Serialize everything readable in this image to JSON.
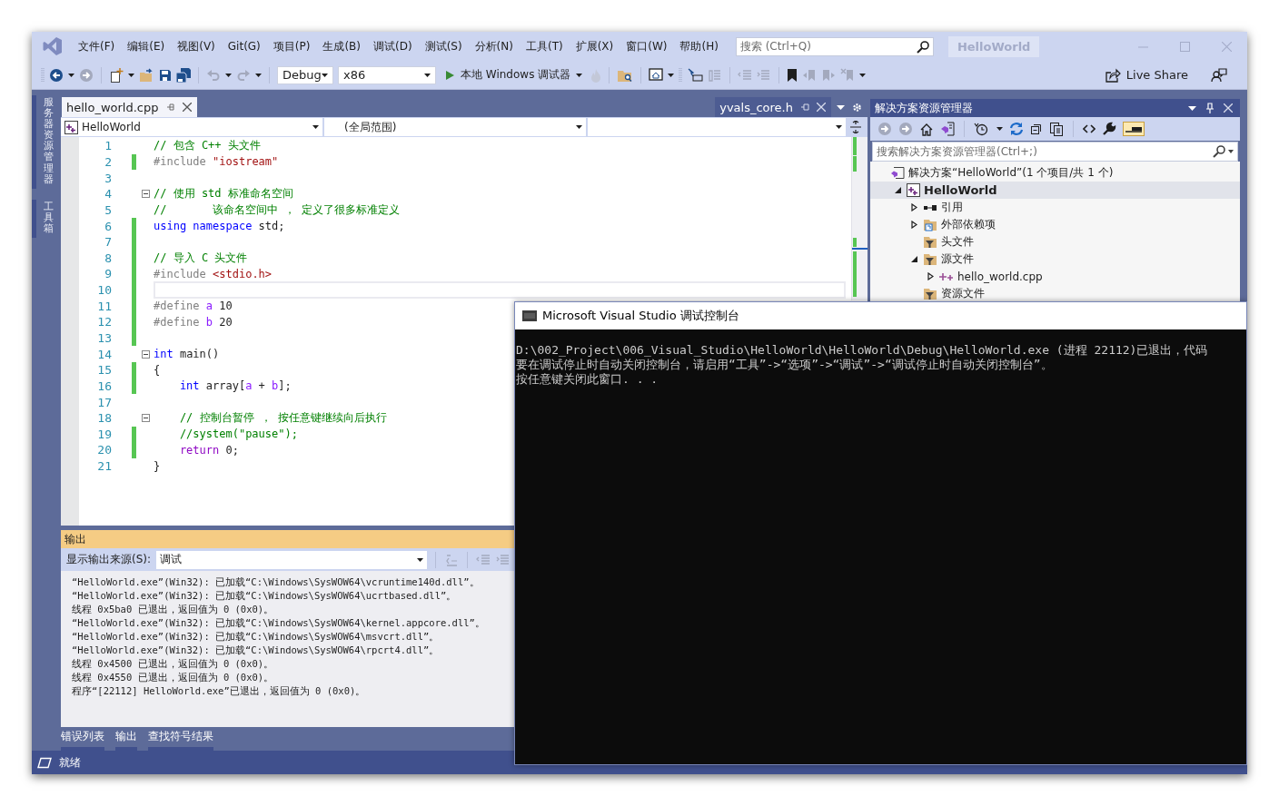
{
  "window": {
    "menu": [
      "文件(F)",
      "编辑(E)",
      "视图(V)",
      "Git(G)",
      "项目(P)",
      "生成(B)",
      "调试(D)",
      "测试(S)",
      "分析(N)",
      "工具(T)",
      "扩展(X)",
      "窗口(W)",
      "帮助(H)"
    ],
    "search": {
      "placeholder": "搜索 (Ctrl+Q)"
    },
    "solution_name": "HelloWorld"
  },
  "toolbar": {
    "configuration": "Debug",
    "platform": "x86",
    "debugger": "本地 Windows 调试器",
    "live_share": "Live Share"
  },
  "side_tabs": [
    "服务器资源管理器",
    "工具箱"
  ],
  "editor": {
    "tabs": [
      {
        "label": "hello_world.cpp",
        "kind": "document",
        "selected": true
      },
      {
        "label": "yvals_core.h",
        "kind": "preview",
        "selected": false
      }
    ],
    "project": "HelloWorld",
    "scope": "(全局范围)",
    "lines": [
      {
        "number": "1",
        "changed": false,
        "foldable": false,
        "current": false,
        "tokens": [
          {
            "kind": "comment",
            "text": "// 包含 C++ 头文件"
          }
        ]
      },
      {
        "number": "2",
        "changed": true,
        "foldable": false,
        "current": false,
        "tokens": [
          {
            "kind": "preproc",
            "text": "#include "
          },
          {
            "kind": "string",
            "text": "\"iostream\""
          }
        ]
      },
      {
        "number": "3",
        "changed": false,
        "foldable": false,
        "current": false
      },
      {
        "number": "4",
        "changed": false,
        "foldable": true,
        "current": false,
        "tokens": [
          {
            "kind": "comment",
            "text": "// 使用 std 标准命名空间"
          }
        ]
      },
      {
        "number": "5",
        "changed": false,
        "foldable": false,
        "current": false,
        "tokens": [
          {
            "kind": "comment",
            "text": "//       该命名空间中 ， 定义了很多标准定义"
          }
        ]
      },
      {
        "number": "6",
        "changed": true,
        "foldable": false,
        "current": false,
        "tokens": [
          {
            "kind": "keyword",
            "text": "using "
          },
          {
            "kind": "keyword",
            "text": "namespace"
          },
          {
            "kind": "plain",
            "text": " std;"
          }
        ]
      },
      {
        "number": "7",
        "changed": true,
        "foldable": false,
        "current": false
      },
      {
        "number": "8",
        "changed": true,
        "foldable": false,
        "current": false,
        "tokens": [
          {
            "kind": "comment",
            "text": "// 导入 C 头文件"
          }
        ]
      },
      {
        "number": "9",
        "changed": true,
        "foldable": false,
        "current": false,
        "tokens": [
          {
            "kind": "preproc",
            "text": "#include "
          },
          {
            "kind": "string",
            "text": "<stdio.h>"
          }
        ]
      },
      {
        "number": "10",
        "changed": true,
        "foldable": false,
        "current": true
      },
      {
        "number": "11",
        "changed": true,
        "foldable": false,
        "current": false,
        "tokens": [
          {
            "kind": "preproc",
            "text": "#define "
          },
          {
            "kind": "macro",
            "text": "a"
          },
          {
            "kind": "plain",
            "text": " 10"
          }
        ]
      },
      {
        "number": "12",
        "changed": true,
        "foldable": false,
        "current": false,
        "tokens": [
          {
            "kind": "preproc",
            "text": "#define "
          },
          {
            "kind": "macro",
            "text": "b"
          },
          {
            "kind": "plain",
            "text": " 20"
          }
        ]
      },
      {
        "number": "13",
        "changed": true,
        "foldable": false,
        "current": false
      },
      {
        "number": "14",
        "changed": false,
        "foldable": true,
        "current": false,
        "tokens": [
          {
            "kind": "keyword",
            "text": "int"
          },
          {
            "kind": "plain",
            "text": " main()"
          }
        ]
      },
      {
        "number": "15",
        "changed": true,
        "foldable": false,
        "current": false,
        "tokens": [
          {
            "kind": "plain",
            "text": "{"
          }
        ]
      },
      {
        "number": "16",
        "changed": true,
        "foldable": false,
        "current": false,
        "tokens": [
          {
            "kind": "keyword",
            "text": "    int"
          },
          {
            "kind": "plain",
            "text": " array["
          },
          {
            "kind": "macro",
            "text": "a"
          },
          {
            "kind": "plain",
            "text": " + "
          },
          {
            "kind": "macro",
            "text": "b"
          },
          {
            "kind": "plain",
            "text": "];"
          }
        ]
      },
      {
        "number": "17",
        "changed": false,
        "foldable": false,
        "current": false
      },
      {
        "number": "18",
        "changed": false,
        "foldable": true,
        "current": false,
        "tokens": [
          {
            "kind": "comment",
            "text": "    // 控制台暂停 ， 按任意键继续向后执行"
          }
        ]
      },
      {
        "number": "19",
        "changed": true,
        "foldable": false,
        "current": false,
        "tokens": [
          {
            "kind": "comment",
            "text": "    //system(\"pause\");"
          }
        ]
      },
      {
        "number": "20",
        "changed": true,
        "foldable": false,
        "current": false,
        "tokens": [
          {
            "kind": "control",
            "text": "    return"
          },
          {
            "kind": "plain",
            "text": " 0;"
          }
        ]
      },
      {
        "number": "21",
        "changed": false,
        "foldable": false,
        "current": false,
        "tokens": [
          {
            "kind": "plain",
            "text": "}"
          }
        ]
      }
    ]
  },
  "output": {
    "title": "输出",
    "source_label": "显示输出来源(S):",
    "source": "调试",
    "lines": [
      "“HelloWorld.exe”(Win32): 已加载“C:\\Windows\\SysWOW64\\vcruntime140d.dll”。",
      "“HelloWorld.exe”(Win32): 已加载“C:\\Windows\\SysWOW64\\ucrtbased.dll”。",
      "线程 0x5ba0 已退出，返回值为 0 (0x0)。",
      "“HelloWorld.exe”(Win32): 已加载“C:\\Windows\\SysWOW64\\kernel.appcore.dll”。",
      "“HelloWorld.exe”(Win32): 已加载“C:\\Windows\\SysWOW64\\msvcrt.dll”。",
      "“HelloWorld.exe”(Win32): 已加载“C:\\Windows\\SysWOW64\\rpcrt4.dll”。",
      "线程 0x4500 已退出，返回值为 0 (0x0)。",
      "线程 0x4550 已退出，返回值为 0 (0x0)。",
      "程序“[22112] HelloWorld.exe”已退出，返回值为 0 (0x0)。"
    ]
  },
  "bottom_tabs": [
    "错误列表",
    "输出",
    "查找符号结果"
  ],
  "solution_explorer": {
    "title": "解决方案资源管理器",
    "preview_on": true,
    "search": {
      "placeholder": "搜索解决方案资源管理器(Ctrl+;)"
    },
    "tree": [
      {
        "label": "解决方案“HelloWorld”(1 个项目/共 1 个)",
        "kind": "solution",
        "selected": false,
        "children": [
          {
            "label": "HelloWorld",
            "kind": "project",
            "expanded": true,
            "selected": true,
            "children": [
              {
                "label": "引用",
                "kind": "references",
                "expanded": false,
                "selected": false
              },
              {
                "label": "外部依赖项",
                "kind": "external",
                "expanded": false,
                "selected": false
              },
              {
                "label": "头文件",
                "kind": "filter",
                "selected": false
              },
              {
                "label": "源文件",
                "kind": "filter",
                "expanded": true,
                "selected": false,
                "children": [
                  {
                    "label": "hello_world.cpp",
                    "kind": "cpp",
                    "expanded": false,
                    "selected": false
                  }
                ]
              },
              {
                "label": "资源文件",
                "kind": "filter",
                "selected": false
              }
            ]
          }
        ]
      }
    ]
  },
  "status_bar": {
    "text": "就绪"
  },
  "console": {
    "title": "Microsoft Visual Studio 调试控制台",
    "lines": [
      "D:\\002_Project\\006_Visual_Studio\\HelloWorld\\HelloWorld\\Debug\\HelloWorld.exe (进程 22112)已退出，代码",
      "要在调试停止时自动关闭控制台，请启用“工具”->“选项”->“调试”->“调试停止时自动关闭控制台”。",
      "按任意键关闭此窗口. . ."
    ]
  }
}
